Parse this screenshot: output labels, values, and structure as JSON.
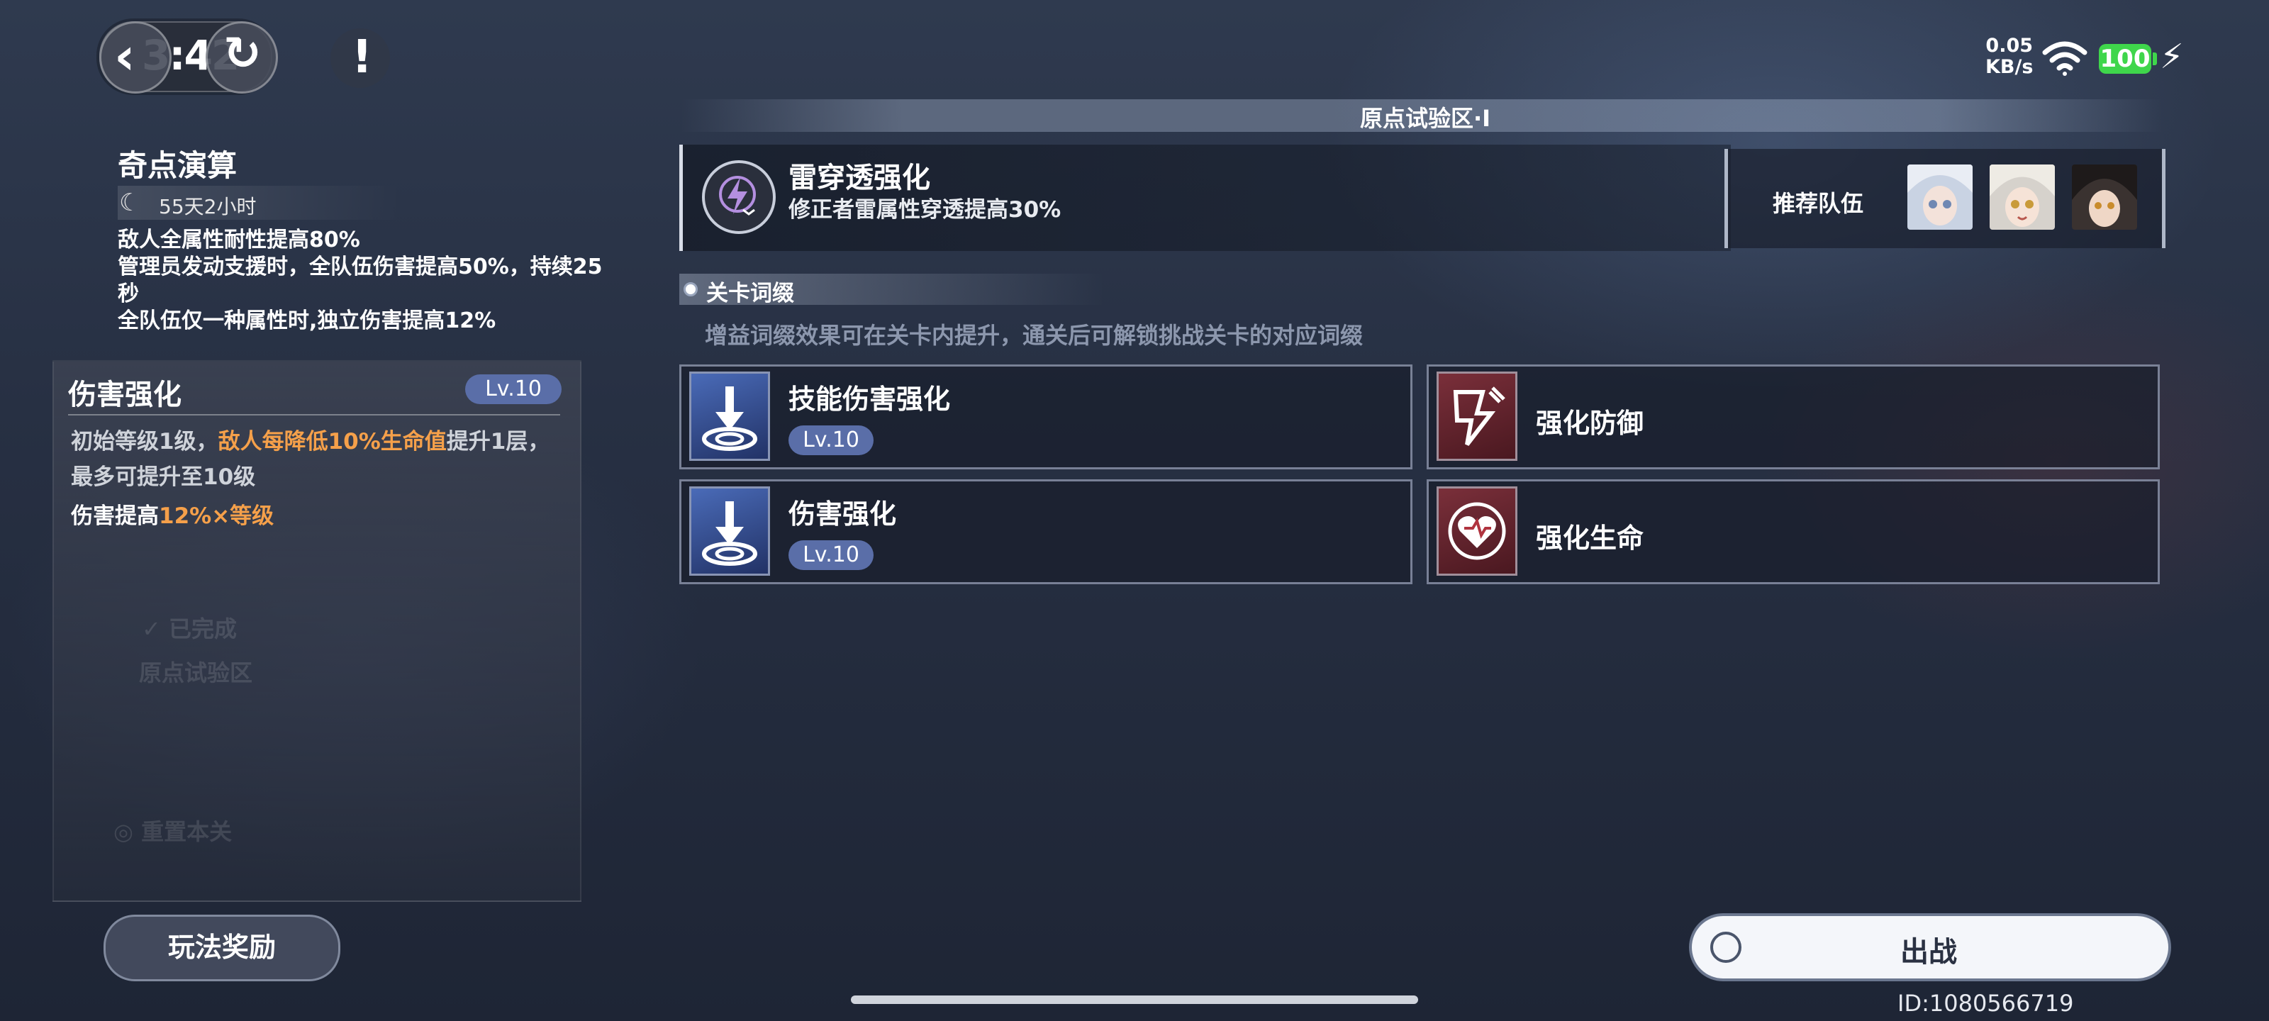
{
  "status_bar": {
    "timer": "3:42",
    "net_speed": "0.05",
    "net_unit": "KB/s",
    "battery": "100"
  },
  "event": {
    "title": "奇点演算",
    "time_left": "55天2小时",
    "effects": [
      "敌人全属性耐性提高80%",
      "管理员发动支援时，全队伍伤害提高50%，持续25",
      "秒",
      "全队伍仅一种属性时,独立伤害提高12%"
    ]
  },
  "buff_detail": {
    "title": "伤害强化",
    "level": "Lv.10",
    "desc_1": "初始等级1级，",
    "desc_highlight": "敌人每降低10%生命值",
    "desc_2": "提升1层，",
    "desc_3": "最多可提升至10级",
    "effect_prefix": "伤害提高",
    "effect_value": "12%×等级",
    "faded_status": "已完成",
    "faded_stage": "原点试验区",
    "faded_reset": "重置本关"
  },
  "rewards_button": "玩法奖励",
  "zone": {
    "title": "原点试验区·I"
  },
  "main_buff": {
    "title": "雷穿透强化",
    "desc": "修正者雷属性穿透提高30%",
    "team_label": "推荐队伍",
    "icon": "lightning-penetration-icon"
  },
  "affixes": {
    "header": "关卡词缀",
    "hint": "增益词缀效果可在关卡内提升，通关后可解锁挑战关卡的对应词缀",
    "items": [
      {
        "name": "技能伤害强化",
        "level": "Lv.10",
        "icon": "damage-boost-icon"
      },
      {
        "name": "强化防御",
        "level": "",
        "icon": "shield-break-icon"
      },
      {
        "name": "伤害强化",
        "level": "Lv.10",
        "icon": "damage-boost-icon"
      },
      {
        "name": "强化生命",
        "level": "",
        "icon": "heart-icon"
      }
    ]
  },
  "deploy_button": "出战",
  "player_id": "ID:1080566719",
  "colors": {
    "accent_orange": "#f5a04a",
    "level_badge": "#5a6ea8",
    "battery_green": "#3fd64b"
  }
}
